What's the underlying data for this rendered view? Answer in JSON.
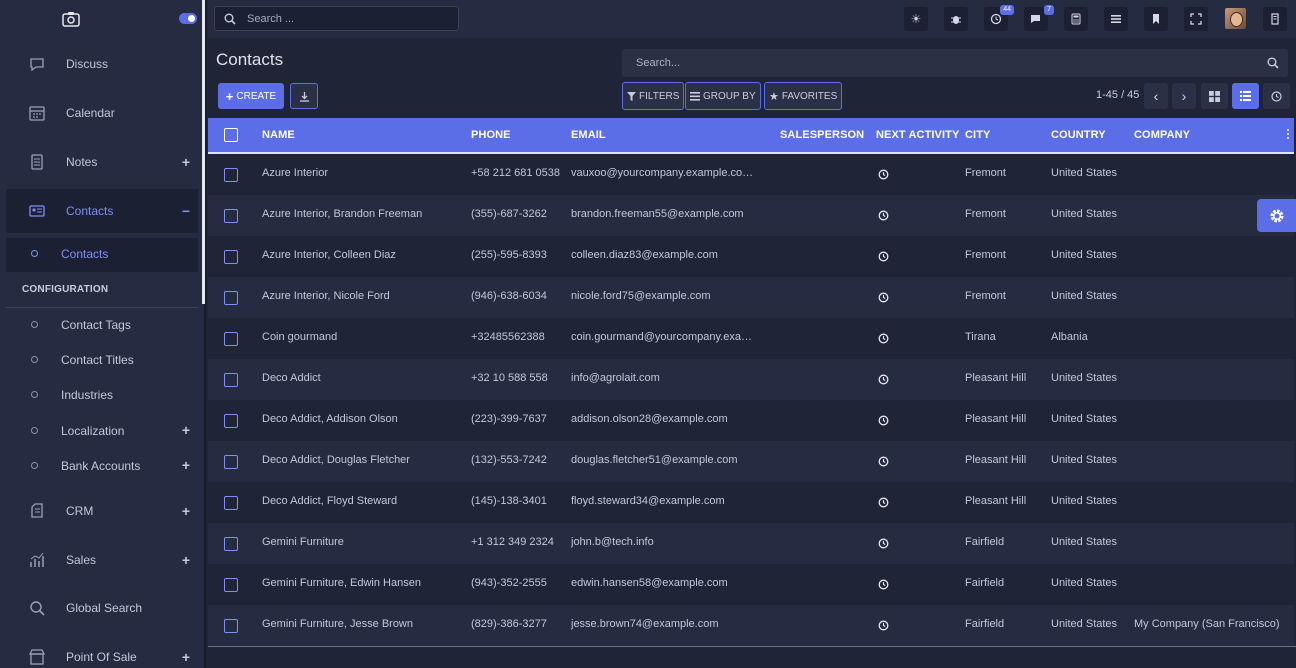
{
  "topbar": {
    "search_placeholder": "Search ...",
    "badges": {
      "activities": "44",
      "messages": "7"
    }
  },
  "sidebar": {
    "items": [
      {
        "label": "Discuss",
        "icon": "chat-icon",
        "has_plus": false
      },
      {
        "label": "Calendar",
        "icon": "calendar-icon",
        "has_plus": false
      },
      {
        "label": "Notes",
        "icon": "notes-icon",
        "has_plus": true
      },
      {
        "label": "Contacts",
        "icon": "contacts-icon",
        "has_plus": true,
        "active": true
      }
    ],
    "contacts_sub": {
      "label": "Contacts"
    },
    "config_heading": "CONFIGURATION",
    "config_items": [
      {
        "label": "Contact Tags"
      },
      {
        "label": "Contact Titles"
      },
      {
        "label": "Industries"
      },
      {
        "label": "Localization",
        "has_plus": true
      },
      {
        "label": "Bank Accounts",
        "has_plus": true
      }
    ],
    "apps": [
      {
        "label": "CRM",
        "icon": "crm-icon",
        "has_plus": true
      },
      {
        "label": "Sales",
        "icon": "sales-chart-icon",
        "has_plus": true
      },
      {
        "label": "Global Search",
        "icon": "search-icon",
        "has_plus": false
      },
      {
        "label": "Point Of Sale",
        "icon": "shop-icon",
        "has_plus": true
      }
    ]
  },
  "control": {
    "title": "Contacts",
    "search_placeholder": "Search...",
    "create_label": "CREATE",
    "filters_label": "FILTERS",
    "groupby_label": "GROUP BY",
    "favorites_label": "FAVORITES",
    "pager": "1-45 / 45"
  },
  "table": {
    "columns": [
      "NAME",
      "PHONE",
      "EMAIL",
      "SALESPERSON",
      "NEXT ACTIVITY",
      "CITY",
      "COUNTRY",
      "COMPANY"
    ],
    "rows": [
      {
        "name": "Azure Interior",
        "phone": "+58 212 681 0538",
        "email": "vauxoo@yourcompany.example.co…",
        "salesperson": "",
        "city": "Fremont",
        "country": "United States",
        "company": ""
      },
      {
        "name": "Azure Interior, Brandon Freeman",
        "phone": "(355)-687-3262",
        "email": "brandon.freeman55@example.com",
        "salesperson": "",
        "city": "Fremont",
        "country": "United States",
        "company": ""
      },
      {
        "name": "Azure Interior, Colleen Diaz",
        "phone": "(255)-595-8393",
        "email": "colleen.diaz83@example.com",
        "salesperson": "",
        "city": "Fremont",
        "country": "United States",
        "company": ""
      },
      {
        "name": "Azure Interior, Nicole Ford",
        "phone": "(946)-638-6034",
        "email": "nicole.ford75@example.com",
        "salesperson": "",
        "city": "Fremont",
        "country": "United States",
        "company": ""
      },
      {
        "name": "Coin gourmand",
        "phone": "+32485562388",
        "email": "coin.gourmand@yourcompany.exa…",
        "salesperson": "",
        "city": "Tirana",
        "country": "Albania",
        "company": ""
      },
      {
        "name": "Deco Addict",
        "phone": "+32 10 588 558",
        "email": "info@agrolait.com",
        "salesperson": "",
        "city": "Pleasant Hill",
        "country": "United States",
        "company": ""
      },
      {
        "name": "Deco Addict, Addison Olson",
        "phone": "(223)-399-7637",
        "email": "addison.olson28@example.com",
        "salesperson": "",
        "city": "Pleasant Hill",
        "country": "United States",
        "company": ""
      },
      {
        "name": "Deco Addict, Douglas Fletcher",
        "phone": "(132)-553-7242",
        "email": "douglas.fletcher51@example.com",
        "salesperson": "",
        "city": "Pleasant Hill",
        "country": "United States",
        "company": ""
      },
      {
        "name": "Deco Addict, Floyd Steward",
        "phone": "(145)-138-3401",
        "email": "floyd.steward34@example.com",
        "salesperson": "",
        "city": "Pleasant Hill",
        "country": "United States",
        "company": ""
      },
      {
        "name": "Gemini Furniture",
        "phone": "+1 312 349 2324",
        "email": "john.b@tech.info",
        "salesperson": "",
        "city": "Fairfield",
        "country": "United States",
        "company": ""
      },
      {
        "name": "Gemini Furniture, Edwin Hansen",
        "phone": "(943)-352-2555",
        "email": "edwin.hansen58@example.com",
        "salesperson": "",
        "city": "Fairfield",
        "country": "United States",
        "company": ""
      },
      {
        "name": "Gemini Furniture, Jesse Brown",
        "phone": "(829)-386-3277",
        "email": "jesse.brown74@example.com",
        "salesperson": "",
        "city": "Fairfield",
        "country": "United States",
        "company": "My Company (San Francisco)"
      }
    ]
  },
  "colors": {
    "accent": "#5b6ee8",
    "sidebar": "#252b40",
    "background": "#1f2436"
  }
}
